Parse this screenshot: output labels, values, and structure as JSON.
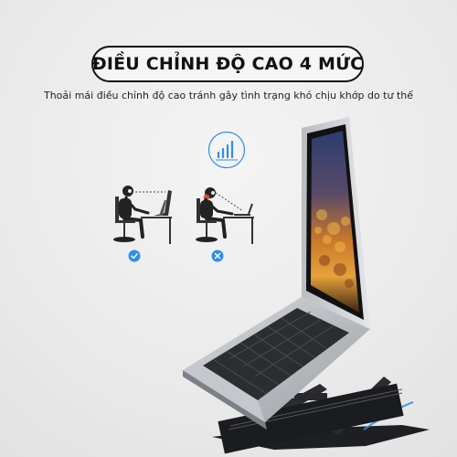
{
  "title": "ĐIỀU CHỈNH ĐỘ CAO 4 MỨC",
  "subtitle": "Thoải mái điều chỉnh độ cao tránh gây tình trạng khó chịu khớp do tư thế",
  "icons": {
    "ergonomics": "bar-chart-rising-icon",
    "good_posture_mark": "check-icon",
    "bad_posture_mark": "x-icon"
  },
  "colors": {
    "accent_blue": "#2f8ee8",
    "badge_border": "#111111",
    "background": "#ececec"
  }
}
